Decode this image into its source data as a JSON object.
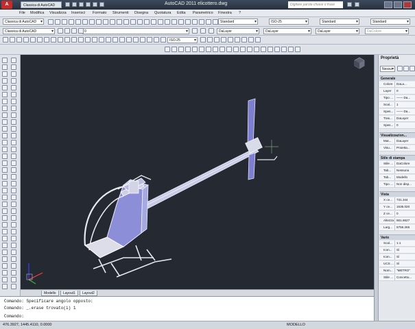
{
  "titlebar": {
    "workspace": "Classica di AutoCAD",
    "title": "AutoCAD 2011    elicottero.dwg",
    "search_placeholder": "Digitare parola chiave o frase"
  },
  "menu": [
    "File",
    "Modifica",
    "Visualizza",
    "Inserisci",
    "Formato",
    "Strumenti",
    "Disegna",
    "Quotatura",
    "Edita",
    "Parametrico",
    "Finestra",
    "?"
  ],
  "toolbar": {
    "workspace_combo": "Classica di AutoCAD",
    "layer_combo": "0",
    "text_style": "Standard",
    "dim_style": "ISO-25",
    "table_style": "Standard",
    "mleader_style": "Standard",
    "color_combo": "DaLayer",
    "linetype_combo": "DaLayer",
    "lineweight_combo": "DaLayer",
    "plotstyle_combo": "DaColore",
    "dim_style_2": "ISO-25"
  },
  "tabs": [
    "Modello",
    "Layout1",
    "Layout2"
  ],
  "command": {
    "line1": "Comando: Specificare angolo opposto:",
    "line2": "Comando: _.erase trovato(i) 1",
    "line3": "Comando:"
  },
  "status": {
    "coords": "476.3927, 1445.4110, 0.0000",
    "model": "MODELLO"
  },
  "properties": {
    "title": "Proprietà",
    "selection": "Nessu",
    "sections": [
      {
        "name": "Generale",
        "rows": [
          [
            "Colore",
            "DaLa..."
          ],
          [
            "Layer",
            "0"
          ],
          [
            "Tipo ...",
            "—— Da..."
          ],
          [
            "Scal...",
            "1"
          ],
          [
            "Spes...",
            "—— Da..."
          ],
          [
            "Tras...",
            "DaLayer"
          ],
          [
            "Spes...",
            "0"
          ]
        ]
      },
      {
        "name": "Visualizzazion...",
        "rows": [
          [
            "Mat...",
            "DaLayer"
          ],
          [
            "Visu...",
            "Proietta..."
          ]
        ]
      },
      {
        "name": "Stile di stampa",
        "rows": [
          [
            "Stile ...",
            "DaColore"
          ],
          [
            "Tab...",
            "Nessuna"
          ],
          [
            "Tab...",
            "Modello"
          ],
          [
            "Tipo ...",
            "Non disp..."
          ]
        ]
      },
      {
        "name": "Vista",
        "rows": [
          [
            "X ce...",
            "731.344"
          ],
          [
            "Y ce...",
            "1535.020"
          ],
          [
            "Z ce...",
            "0"
          ],
          [
            "Altezza",
            "561.6627"
          ],
          [
            "Larg...",
            "5756.265"
          ]
        ]
      },
      {
        "name": "Vario",
        "rows": [
          [
            "Scal...",
            "1:1"
          ],
          [
            "Icon...",
            "Sì"
          ],
          [
            "Icon...",
            "Sì"
          ],
          [
            "UCS ...",
            "Sì"
          ],
          [
            "Nom...",
            "\"METRO\""
          ],
          [
            "Stile ...",
            "Concettu..."
          ]
        ]
      }
    ]
  },
  "colors": {
    "viewport_bg": "#252932",
    "model_fill": "#8c8fd8",
    "model_edge": "#e8e8f0"
  }
}
